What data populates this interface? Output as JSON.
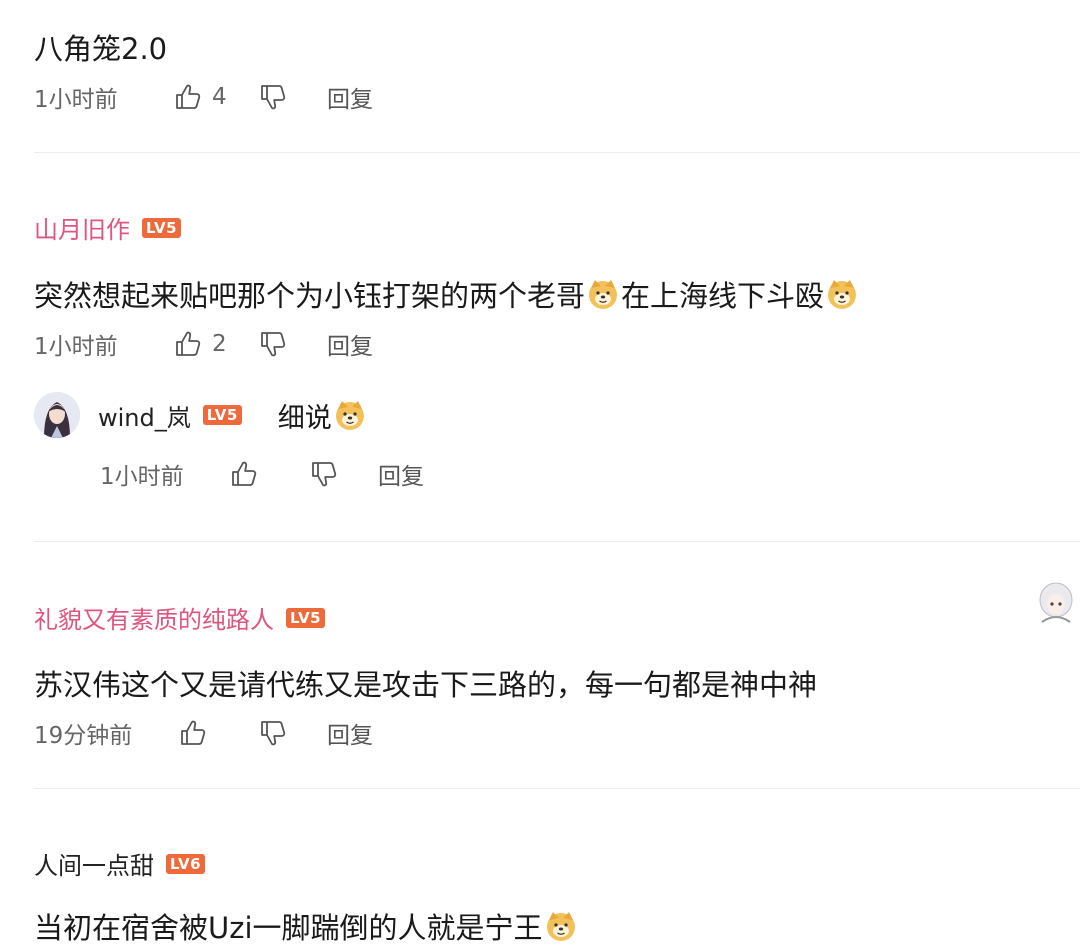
{
  "comments": [
    {
      "text": "八角笼2.0",
      "time": "1小时前",
      "likes": "4",
      "reply_label": "回复"
    },
    {
      "author": "山月旧作",
      "level": "LV5",
      "text_a": "突然想起来贴吧那个为小钰打架的两个老哥",
      "text_b": "在上海线下斗殴",
      "emoji": "doge-emoji",
      "time": "1小时前",
      "likes": "2",
      "reply_label": "回复",
      "reply": {
        "author": "wind_岚",
        "level": "LV5",
        "text": "细说",
        "emoji": "doge-emoji",
        "time": "1小时前",
        "reply_label": "回复"
      }
    },
    {
      "author": "礼貌又有素质的纯路人",
      "level": "LV5",
      "text": "苏汉伟这个又是请代练又是攻击下三路的，每一句都是神中神",
      "time": "19分钟前",
      "reply_label": "回复"
    },
    {
      "author": "人间一点甜",
      "level": "LV6",
      "text": "当初在宿舍被Uzi一脚踹倒的人就是宁王",
      "emoji": "doge-emoji"
    }
  ],
  "colors": {
    "author_pink": "#e0557d",
    "level_badge": "#ef6a3a",
    "meta_gray": "#666666"
  }
}
